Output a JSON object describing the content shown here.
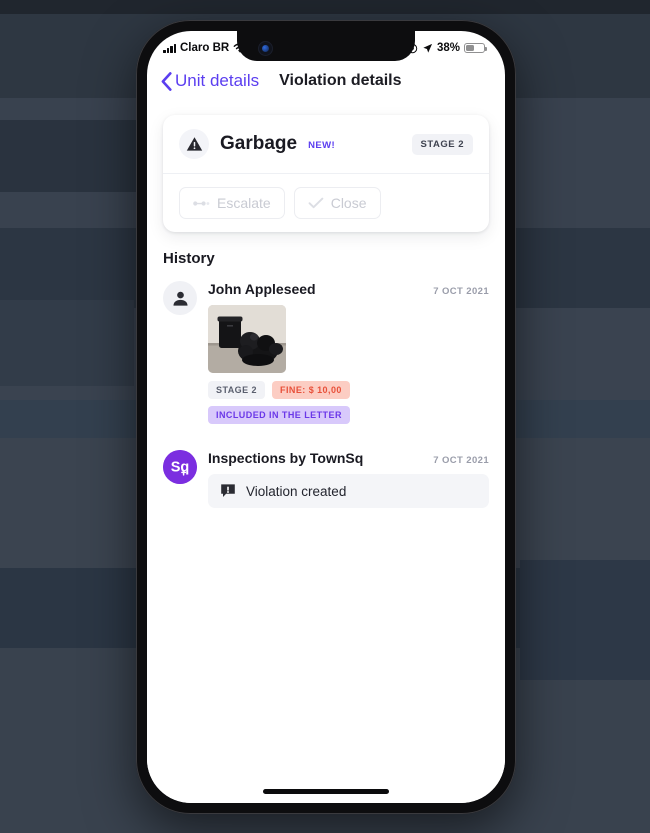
{
  "statusbar": {
    "carrier": "Claro BR",
    "signal_icon": "cellular-bars-icon",
    "wifi_icon": "wifi-icon",
    "alarm_icon": "alarm-clock-icon",
    "location_icon": "location-arrow-icon",
    "battery_percent": "38%",
    "battery_icon": "battery-icon"
  },
  "navbar": {
    "back_label": "Unit details",
    "back_icon": "chevron-left-icon",
    "title": "Violation details"
  },
  "violation": {
    "warning_icon": "warning-triangle-icon",
    "title": "Garbage",
    "new_flag": "NEW!",
    "stage": "STAGE 2",
    "actions": [
      {
        "label": "Escalate",
        "icon": "escalate-arrow-icon",
        "disabled": true
      },
      {
        "label": "Close",
        "icon": "check-icon",
        "disabled": true
      }
    ]
  },
  "history": {
    "heading": "History",
    "entries": [
      {
        "avatar_icon": "person-avatar-icon",
        "name": "John Appleseed",
        "date": "7 OCT 2021",
        "photo_alt": "garbage-photo",
        "tags": [
          {
            "label": "STAGE 2",
            "style": "gray"
          },
          {
            "label": "FINE: $ 10,00",
            "style": "red"
          },
          {
            "label": "INCLUDED IN THE LETTER",
            "style": "purple"
          }
        ]
      },
      {
        "avatar_icon": "townsq-logo-icon",
        "avatar_text": "Sq",
        "name": "Inspections by TownSq",
        "date": "7 OCT 2021",
        "event_icon": "comment-alert-icon",
        "event_text": "Violation created"
      }
    ]
  },
  "colors": {
    "accent_purple": "#5b3ef0",
    "brand_purple": "#7b2ee0",
    "tag_red_bg": "#fccdc3",
    "tag_red_text": "#e8503a",
    "tag_purple_bg": "#d8c9fb",
    "tag_purple_text": "#6b38e8",
    "backdrop": "#333c49"
  }
}
